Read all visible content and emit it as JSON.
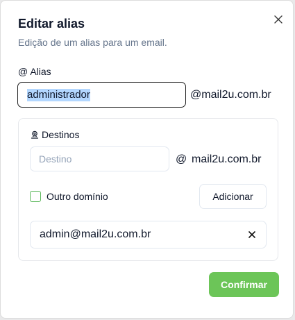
{
  "dialog": {
    "title": "Editar alias",
    "subtitle": "Edição de um alias para um email.",
    "close_icon": "close-icon"
  },
  "alias": {
    "label": "@ Alias",
    "value": "administrador",
    "domain": "@mail2u.com.br"
  },
  "destinos": {
    "label": "Destinos",
    "icon": "user-pin-icon",
    "input_placeholder": "Destino",
    "at_symbol": "@",
    "domain": "mail2u.com.br",
    "checkbox_label": "Outro domínio",
    "checkbox_checked": false,
    "add_button": "Adicionar",
    "items": [
      {
        "email": "admin@mail2u.com.br"
      }
    ]
  },
  "footer": {
    "confirm_button": "Confirmar"
  },
  "colors": {
    "primary": "#6cc558",
    "checkbox_border": "#5cb85c",
    "selection": "#b3d7ff"
  }
}
